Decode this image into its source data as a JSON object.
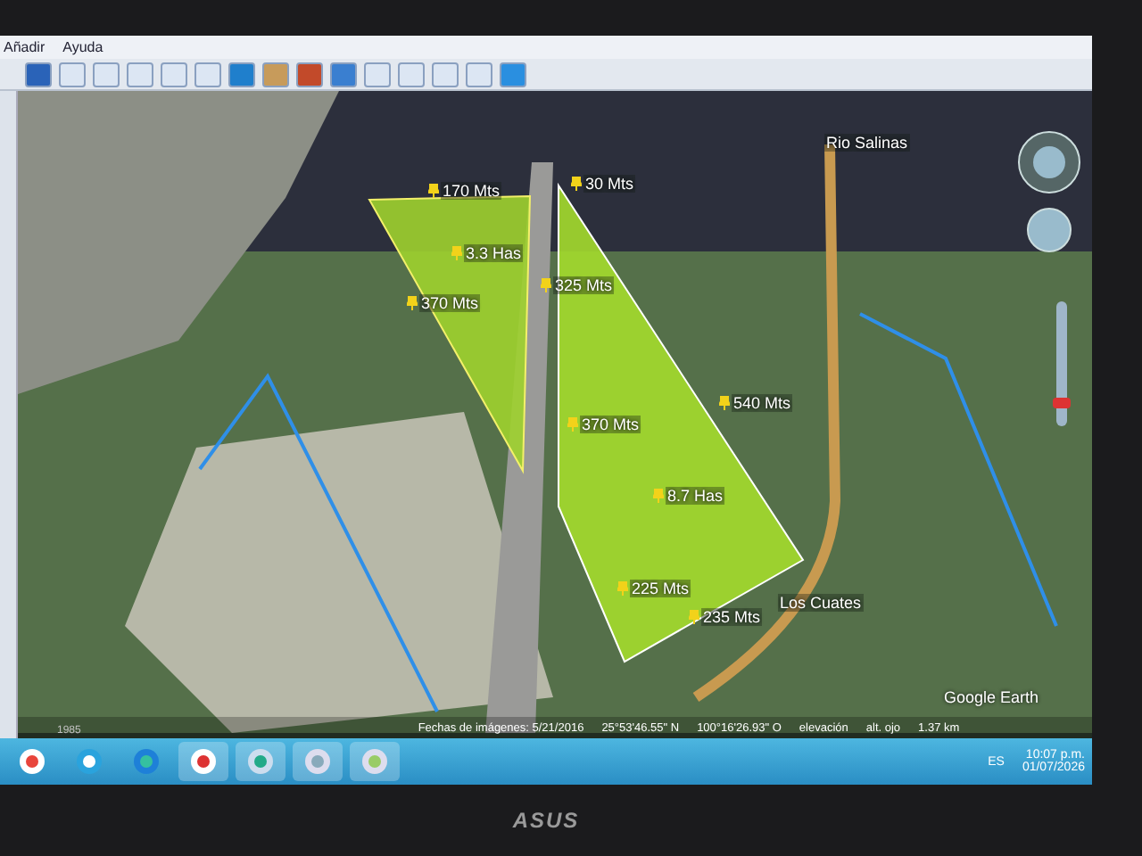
{
  "menu_bar": {
    "items": [
      "Añadir",
      "Ayuda"
    ]
  },
  "map": {
    "labels": [
      {
        "kind": "measure",
        "text": "170 Mts"
      },
      {
        "kind": "measure",
        "text": "30 Mts"
      },
      {
        "kind": "measure",
        "text": "3.3 Has"
      },
      {
        "kind": "measure",
        "text": "325 Mts"
      },
      {
        "kind": "measure",
        "text": "370 Mts"
      },
      {
        "kind": "measure",
        "text": "370 Mts"
      },
      {
        "kind": "measure",
        "text": "540 Mts"
      },
      {
        "kind": "measure",
        "text": "8.7 Has"
      },
      {
        "kind": "measure",
        "text": "225 Mts"
      },
      {
        "kind": "measure",
        "text": "235 Mts"
      },
      {
        "kind": "place",
        "text": "Los Cuates"
      },
      {
        "kind": "place",
        "text": "Rio Salinas"
      }
    ],
    "zoom_slider": {
      "level": 0.15
    },
    "brand": "Google Earth",
    "year": "1985"
  },
  "status_bar": [
    "Fechas de imágenes: 5/21/2016",
    "25°53'46.55\" N",
    "100°16'26.93\" O",
    "elevación",
    "alt. ojo",
    "1.37 km"
  ],
  "taskbar": {
    "language": "ES",
    "time": "10:07 p.m.",
    "date": "01/07/2026"
  },
  "monitor": {
    "brand": "ASUS"
  }
}
